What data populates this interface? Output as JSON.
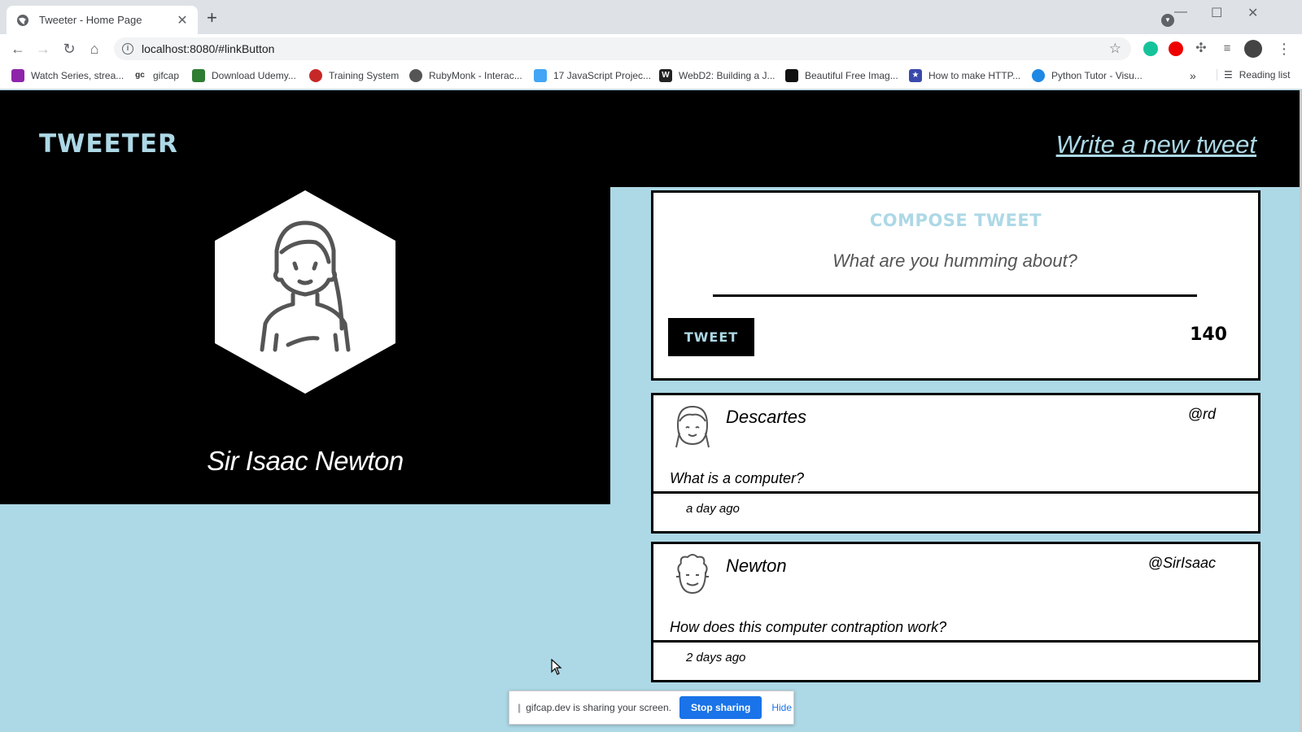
{
  "browser": {
    "tab_title": "Tweeter - Home Page",
    "url": "localhost:8080/#linkButton",
    "bookmarks": [
      {
        "label": "Watch Series, strea...",
        "icon": "purple-icon",
        "color": "#8e24aa"
      },
      {
        "label": "gifcap",
        "icon": "gc-icon",
        "color": "#333333"
      },
      {
        "label": "Download Udemy...",
        "icon": "ftu-icon",
        "color": "#2e7d32"
      },
      {
        "label": "Training System",
        "icon": "red-apple-icon",
        "color": "#c62828"
      },
      {
        "label": "RubyMonk - Interac...",
        "icon": "globe-icon",
        "color": "#555555"
      },
      {
        "label": "17 JavaScript Projec...",
        "icon": "medium-icon",
        "color": "#42a5f5"
      },
      {
        "label": "WebD2: Building a J...",
        "icon": "w-icon",
        "color": "#222222"
      },
      {
        "label": "Beautiful Free Imag...",
        "icon": "unsplash-icon",
        "color": "#111111"
      },
      {
        "label": "How to make HTTP...",
        "icon": "star-badge-icon",
        "color": "#3949ab"
      },
      {
        "label": "Python Tutor - Visu...",
        "icon": "python-icon",
        "color": "#1e88e5"
      }
    ],
    "reading_list": "Reading list"
  },
  "header": {
    "logo": "TWEETER",
    "write_link": "Write a new tweet"
  },
  "profile": {
    "name": "Sir Isaac Newton"
  },
  "compose": {
    "title": "COMPOSE TWEET",
    "placeholder": "What are you humming about?",
    "button": "TWEET",
    "counter": "140"
  },
  "tweets": [
    {
      "name": "Descartes",
      "handle": "@rd",
      "text": "What is a computer?",
      "time": "a day ago"
    },
    {
      "name": "Newton",
      "handle": "@SirIsaac",
      "text": "How does this computer contraption work?",
      "time": "2 days ago"
    }
  ],
  "share_bar": {
    "message": "gifcap.dev is sharing your screen.",
    "stop": "Stop sharing",
    "hide": "Hide"
  },
  "colors": {
    "accent": "#add8e6",
    "background": "#000000"
  }
}
